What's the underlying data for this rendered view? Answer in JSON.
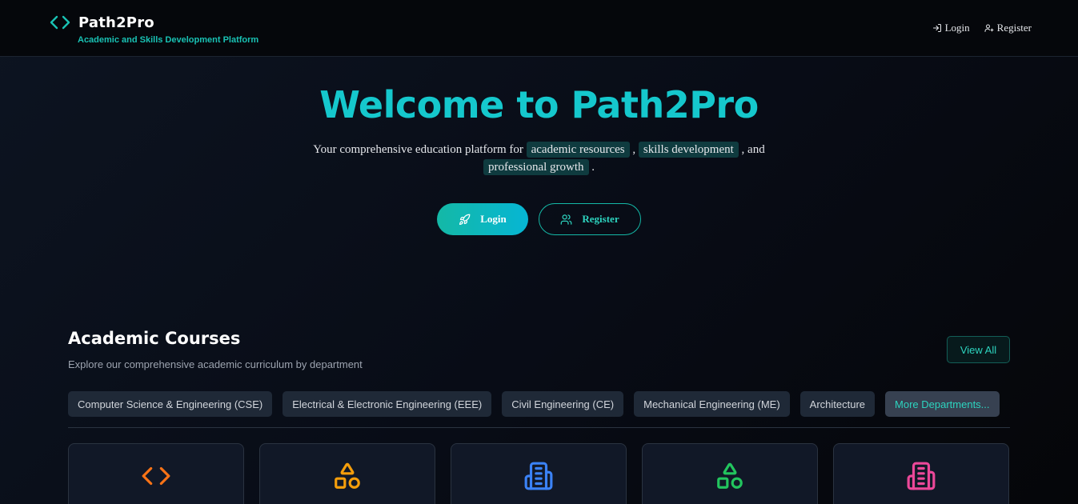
{
  "header": {
    "brand_title": "Path2Pro",
    "brand_subtitle": "Academic and Skills Development Platform",
    "brand_icon": "code-icon",
    "nav": {
      "login_label": "Login",
      "register_label": "Register"
    }
  },
  "hero": {
    "title": "Welcome to Path2Pro",
    "desc_prefix": "Your comprehensive education platform for ",
    "highlight_1": "academic resources",
    "sep_1": " , ",
    "highlight_2": "skills development",
    "sep_2": " , and ",
    "highlight_3": "professional growth",
    "desc_suffix": " .",
    "login_label": "Login",
    "register_label": "Register"
  },
  "courses": {
    "title": "Academic Courses",
    "subtitle": "Explore our comprehensive academic curriculum by department",
    "view_all_label": "View All",
    "departments": [
      "Computer Science & Engineering (CSE)",
      "Electrical & Electronic Engineering (EEE)",
      "Civil Engineering (CE)",
      "Mechanical Engineering (ME)",
      "Architecture"
    ],
    "more_label": "More Departments...",
    "cards": [
      {
        "icon": "code-icon",
        "color": "#f97316"
      },
      {
        "icon": "shapes-icon",
        "color": "#f59e0b"
      },
      {
        "icon": "building-icon",
        "color": "#3b82f6"
      },
      {
        "icon": "shapes-icon",
        "color": "#22c55e"
      },
      {
        "icon": "building-icon",
        "color": "#ec4899"
      }
    ]
  },
  "colors": {
    "accent": "#15c8cd",
    "teal": "#14b8a6",
    "background": "#080c16"
  }
}
